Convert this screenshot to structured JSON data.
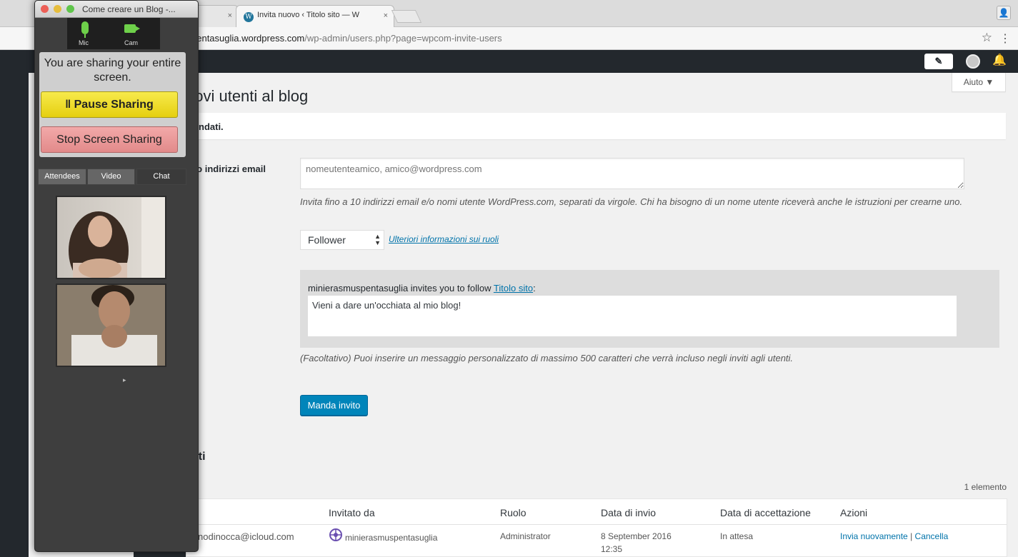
{
  "browser": {
    "tab1": {
      "close": "×"
    },
    "tab2": {
      "title": "Invita nuovo ‹ Titolo sito — W",
      "close": "×"
    },
    "url_host": "pentasuglia.wordpress.com",
    "url_path": "/wp-admin/users.php?page=wpcom-invite-users",
    "star": "☆",
    "menu": "⋮",
    "profile": "👤"
  },
  "adminbar": {
    "write": "✎",
    "notif": "🔔"
  },
  "help_tab": "Aiuto ▼",
  "page": {
    "title": "uovi utenti al blog",
    "notice": "ndati.",
    "users_label": "te o indirizzi email",
    "users_placeholder": "nomeutenteamico, amico@wordpress.com",
    "users_help": "Invita fino a 10 indirizzi email e/o nomi utente WordPress.com, separati da virgole. Chi ha bisogno di un nome utente riceverà anche le istruzioni per crearne uno.",
    "role_value": "Follower",
    "roles_link": "Ulteriori informazioni sui ruoli",
    "msg_prefix": "minierasmuspentasuglia invites you to follow ",
    "msg_site": "Titolo sito",
    "msg_suffix": ":",
    "msg_text": "Vieni a dare un'occhiata al mio blog!",
    "optional_text": "(Facoltativo) Puoi inserire un messaggio personalizzato di massimo 500 caratteri che verrà incluso negli inviti agli utenti.",
    "send_button": "Manda invito",
    "section_title": "sati",
    "items_count": "1 elemento"
  },
  "table": {
    "headers": [
      "Invitato da",
      "Ruolo",
      "Data di invio",
      "Data di accettazione",
      "Azioni"
    ],
    "row": {
      "email": "nodinocca@icloud.com",
      "invited_by": "minierasmuspentasuglia",
      "role": "Administrator",
      "date_line1": "8 September 2016",
      "date_line2": "12:35",
      "accepted": "In attesa",
      "resend": "Invia nuovamente",
      "sep": "|",
      "cancel": "Cancella"
    }
  },
  "share": {
    "window_title": "Come creare un Blog -...",
    "mic": "Mic",
    "cam": "Cam",
    "sharing_text": "You are sharing your entire screen.",
    "pause": "ǁ Pause Sharing",
    "stop": "Stop Screen Sharing",
    "tabs": [
      "Attendees",
      "Video",
      "Chat"
    ]
  },
  "colors": {
    "wp_blue": "#0085ba",
    "admin_bar": "#23282d",
    "link": "#0073aa",
    "pause_yellow": "#f2e23a",
    "stop_red": "#e99a9a"
  }
}
